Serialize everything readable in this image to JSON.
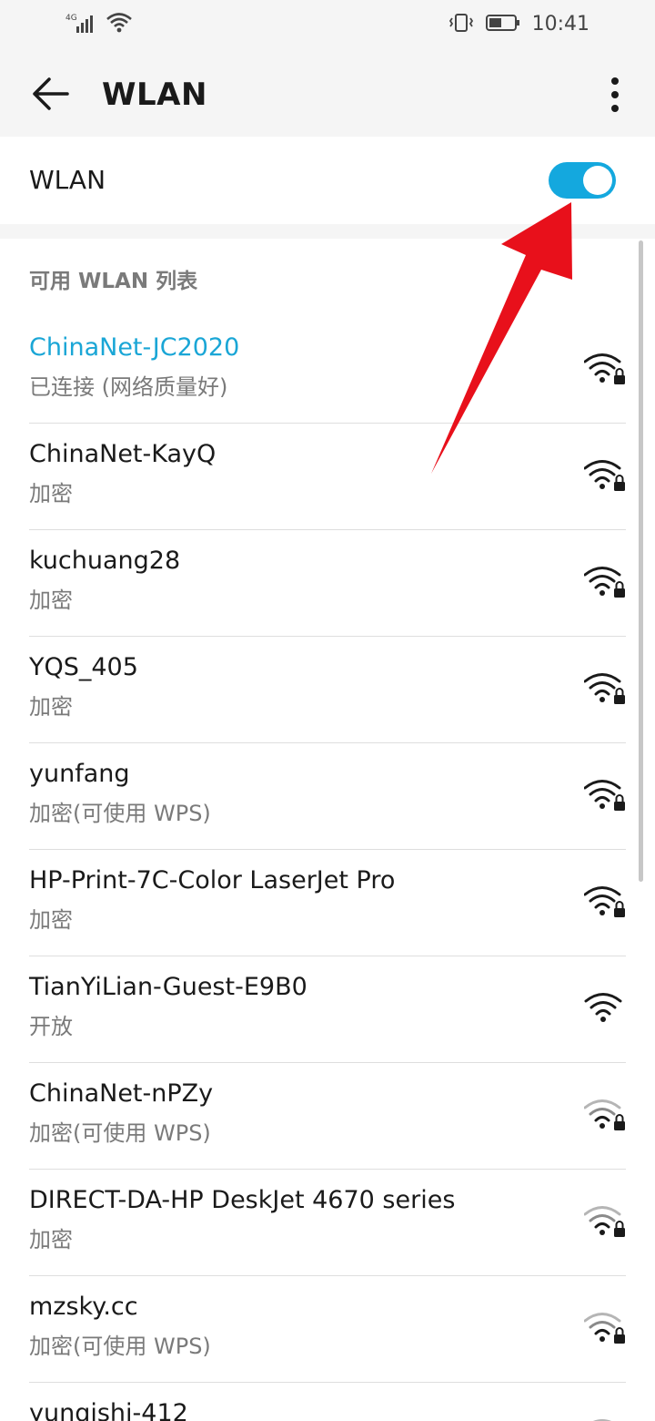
{
  "status_bar": {
    "network": "4G",
    "time": "10:41"
  },
  "app_bar": {
    "title": "WLAN"
  },
  "wlan_toggle": {
    "label": "WLAN",
    "enabled": true
  },
  "available": {
    "title": "可用 WLAN 列表",
    "networks": [
      {
        "name": "ChinaNet-JC2020",
        "status": "已连接 (网络质量好)",
        "connected": true,
        "locked": true,
        "signal": "strong"
      },
      {
        "name": "ChinaNet-KayQ",
        "status": "加密",
        "connected": false,
        "locked": true,
        "signal": "strong"
      },
      {
        "name": "kuchuang28",
        "status": "加密",
        "connected": false,
        "locked": true,
        "signal": "strong"
      },
      {
        "name": "YQS_405",
        "status": "加密",
        "connected": false,
        "locked": true,
        "signal": "strong"
      },
      {
        "name": "yunfang",
        "status": "加密(可使用 WPS)",
        "connected": false,
        "locked": true,
        "signal": "strong"
      },
      {
        "name": "HP-Print-7C-Color LaserJet Pro",
        "status": "加密",
        "connected": false,
        "locked": true,
        "signal": "strong"
      },
      {
        "name": "TianYiLian-Guest-E9B0",
        "status": "开放",
        "connected": false,
        "locked": false,
        "signal": "strong"
      },
      {
        "name": "ChinaNet-nPZy",
        "status": "加密(可使用 WPS)",
        "connected": false,
        "locked": true,
        "signal": "weak"
      },
      {
        "name": "DIRECT-DA-HP DeskJet 4670 series",
        "status": "加密",
        "connected": false,
        "locked": true,
        "signal": "weak"
      },
      {
        "name": "mzsky.cc",
        "status": "加密(可使用 WPS)",
        "connected": false,
        "locked": true,
        "signal": "weak"
      },
      {
        "name": "yunqishi-412",
        "status": "",
        "connected": false,
        "locked": true,
        "signal": "weak"
      }
    ]
  },
  "colors": {
    "accent": "#14a8de",
    "connected_text": "#1aa6d6",
    "arrow": "#e8101b"
  }
}
